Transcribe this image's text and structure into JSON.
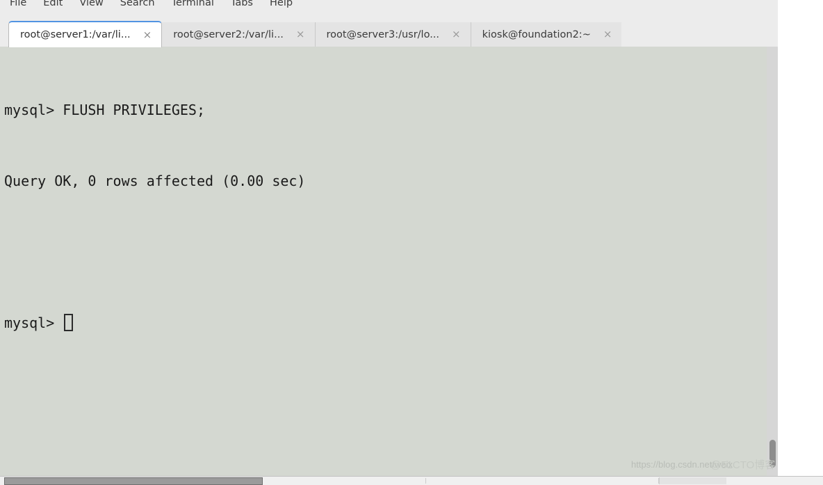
{
  "menu": {
    "items": [
      {
        "label": "File"
      },
      {
        "label": "Edit"
      },
      {
        "label": "View"
      },
      {
        "label": "Search"
      },
      {
        "label": "Terminal"
      },
      {
        "label": "Tabs"
      },
      {
        "label": "Help"
      }
    ]
  },
  "tabs": {
    "close_glyph": "×",
    "items": [
      {
        "label": "root@server1:/var/li...",
        "active": true
      },
      {
        "label": "root@server2:/var/li...",
        "active": false
      },
      {
        "label": "root@server3:/usr/lo...",
        "active": false
      },
      {
        "label": "kiosk@foundation2:~",
        "active": false
      }
    ]
  },
  "terminal": {
    "lines": [
      "mysql> FLUSH PRIVILEGES;",
      "Query OK, 0 rows affected (0.00 sec)",
      "",
      "mysql> "
    ],
    "prompt": "mysql> ",
    "command": "FLUSH PRIVILEGES;",
    "result": "Query OK, 0 rows affected (0.00 sec)",
    "background_color": "#d4d8d1",
    "text_color": "#1a1a1a",
    "cursor_visible": true
  },
  "scrollbar": {
    "position_percent": 100
  },
  "watermark": {
    "url_text": "https://blog.csdn.net/weix",
    "overlay_text": "@51CTO博客"
  },
  "colors": {
    "accent": "#5294e2",
    "menu_bar": "#ececec",
    "terminal_bg": "#d4d8d1",
    "active_tab_bg": "#ffffff",
    "inactive_tab_bg": "#e4e4e4"
  }
}
